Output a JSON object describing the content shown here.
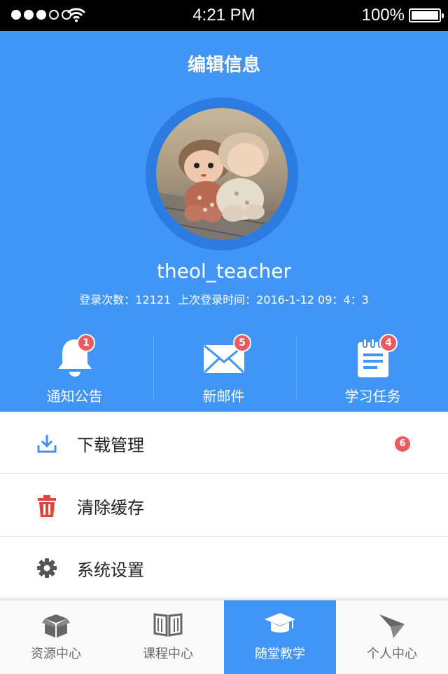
{
  "status_bar": {
    "time": "4:21 PM",
    "battery": "100%",
    "signal_icon": "signal-dots-icon",
    "wifi_icon": "wifi-icon",
    "battery_icon": "battery-icon"
  },
  "header": {
    "title": "编辑信息",
    "username": "theol_teacher",
    "login_count": "登录次数：12121",
    "last_login": "上次登录时间：2016-1-12 09：4：3",
    "avatar": "avatar-photo-dolls"
  },
  "quick_actions": [
    {
      "label": "通知公告",
      "badge": "1",
      "icon": "bell-icon"
    },
    {
      "label": "新邮件",
      "badge": "5",
      "icon": "mail-icon"
    },
    {
      "label": "学习任务",
      "badge": "4",
      "icon": "clipboard-icon"
    }
  ],
  "menu": [
    {
      "label": "下载管理",
      "badge": "6",
      "icon": "download-icon"
    },
    {
      "label": "清除缓存",
      "icon": "trash-icon"
    },
    {
      "label": "系统设置",
      "icon": "gear-icon"
    }
  ],
  "tabs": [
    {
      "label": "资源中心",
      "icon": "box-icon"
    },
    {
      "label": "课程中心",
      "icon": "book-icon"
    },
    {
      "label": "随堂教学",
      "icon": "graduation-cap-icon",
      "active": true
    },
    {
      "label": "个人中心",
      "icon": "paper-plane-icon"
    }
  ],
  "colors": {
    "primary": "#4095f6",
    "avatar_ring": "#2b7be0",
    "badge": "#e85b5f",
    "download_icon": "#4a8df0",
    "trash_icon": "#e0453a",
    "gear_icon": "#555555"
  }
}
